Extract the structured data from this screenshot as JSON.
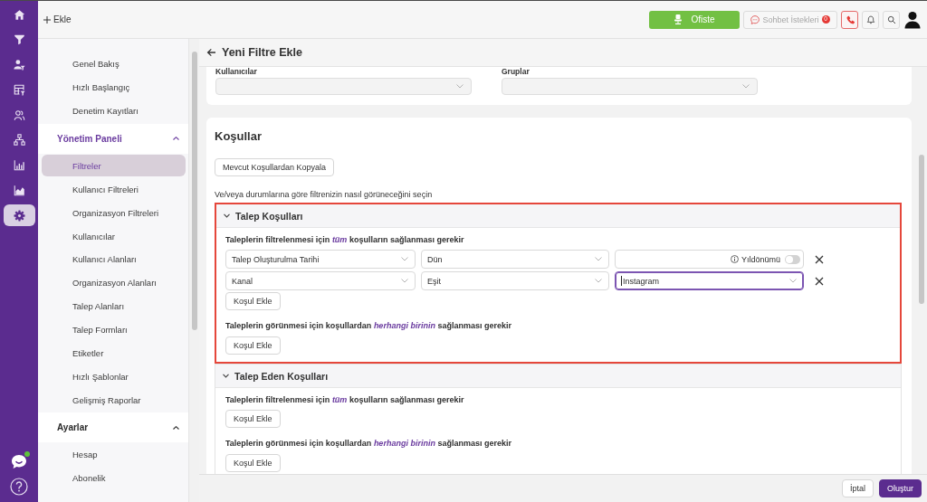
{
  "rail": {
    "items": [
      {
        "selected": false
      },
      {
        "selected": false
      },
      {
        "selected": false
      },
      {
        "selected": false
      },
      {
        "selected": false
      },
      {
        "selected": false
      },
      {
        "selected": false
      },
      {
        "selected": false
      },
      {
        "selected": true
      }
    ],
    "chat": {
      "online": true
    }
  },
  "topbar": {
    "add_button": "Ekle",
    "status_button": "Ofiste",
    "chat_requests": {
      "label": "Sohbet İstekleri",
      "count": "0"
    }
  },
  "sidebar": {
    "groups": [
      {
        "items": [
          {
            "label": "Genel Bakış",
            "selected": false
          },
          {
            "label": "Hızlı Başlangıç",
            "selected": false
          },
          {
            "label": "Denetim Kayıtları",
            "selected": false
          }
        ]
      },
      {
        "title": "Yönetim Paneli",
        "active": true,
        "expanded": true,
        "items": [
          {
            "label": "Filtreler",
            "selected": true
          },
          {
            "label": "Kullanıcı Filtreleri",
            "selected": false
          },
          {
            "label": "Organizasyon Filtreleri",
            "selected": false
          },
          {
            "label": "Kullanıcılar",
            "selected": false
          },
          {
            "label": "Kullanıcı Alanları",
            "selected": false
          },
          {
            "label": "Organizasyon Alanları",
            "selected": false
          },
          {
            "label": "Talep Alanları",
            "selected": false
          },
          {
            "label": "Talep Formları",
            "selected": false
          },
          {
            "label": "Etiketler",
            "selected": false
          },
          {
            "label": "Hızlı Şablonlar",
            "selected": false
          },
          {
            "label": "Gelişmiş Raporlar",
            "selected": false
          }
        ]
      },
      {
        "title": "Ayarlar",
        "active": false,
        "expanded": true,
        "items": [
          {
            "label": "Hesap",
            "selected": false
          },
          {
            "label": "Abonelik",
            "selected": false
          }
        ]
      }
    ]
  },
  "page": {
    "title": "Yeni Filtre Ekle"
  },
  "access": {
    "fields": [
      {
        "label": "Kullanıcılar",
        "disabled": true
      },
      {
        "label": "Gruplar",
        "disabled": true
      }
    ]
  },
  "conditions": {
    "title": "Koşullar",
    "copy_button": "Mevcut Koşullardan Kopyala",
    "hint": "Ve/veya durumlarına göre filtrenizin nasıl görüneceğini seçin",
    "sections": [
      {
        "title": "Talep Koşulları",
        "expanded": true,
        "highlighted": true,
        "all": {
          "text": "Taleplerin filtrelenmesi için *tüm* koşulların sağlanması gerekir",
          "rows": [
            {
              "field": "Talep Oluşturulma Tarihi",
              "operator": "Dün",
              "value": {
                "kind": "toggle",
                "label": "Yıldönümü",
                "on": false
              }
            },
            {
              "field": "Kanal",
              "operator": "Eşit",
              "value": {
                "kind": "select",
                "text": "Instagram",
                "focused": true
              }
            }
          ],
          "add_button": "Koşul Ekle"
        },
        "any": {
          "text": "Taleplerin görünmesi için koşullardan *herhangi birinin* sağlanması gerekir",
          "add_button": "Koşul Ekle"
        }
      },
      {
        "title": "Talep Eden Koşulları",
        "expanded": true,
        "highlighted": false,
        "all": {
          "text": "Taleplerin filtrelenmesi için *tüm* koşulların sağlanması gerekir",
          "add_button": "Koşul Ekle"
        },
        "any": {
          "text": "Taleplerin görünmesi için koşullardan *herhangi birinin* sağlanması gerekir",
          "add_button": "Koşul Ekle"
        }
      }
    ]
  },
  "footer": {
    "buttons": [
      {
        "label": "İptal",
        "kind": "secondary"
      },
      {
        "label": "Oluştur",
        "kind": "primary"
      }
    ]
  }
}
